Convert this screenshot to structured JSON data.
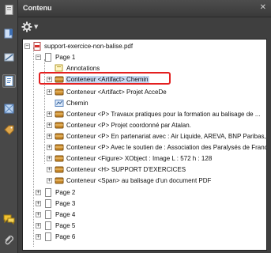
{
  "panel": {
    "title": "Contenu",
    "close": "✕",
    "options_icon": "gear-icon"
  },
  "left_tools": [
    "page-thumbnails-icon",
    "bookmarks-icon",
    "signatures-icon",
    "content-icon",
    "model-tree-icon",
    "tags-icon",
    "comments-icon",
    "attachments-icon"
  ],
  "tree": {
    "root": "support-exercice-non-balise.pdf",
    "page1": "Page 1",
    "page1_children": [
      {
        "label": "Annotations",
        "icon": "annotations-icon",
        "toggle": ""
      },
      {
        "label": "Conteneur <Artifact> Chemin",
        "icon": "container-icon",
        "toggle": "+",
        "selected": true
      },
      {
        "label": "Conteneur <Artifact> Projet AcceDe",
        "icon": "container-icon",
        "toggle": "+"
      },
      {
        "label": "Chemin",
        "icon": "path-icon",
        "toggle": ""
      },
      {
        "label": "Conteneur <P> Travaux pratiques pour la formation au balisage de ...",
        "icon": "container-icon",
        "toggle": "+"
      },
      {
        "label": "Conteneur <P> Projet coordonné par Atalan.",
        "icon": "container-icon",
        "toggle": "+"
      },
      {
        "label": "Conteneur <P> En partenariat avec : Air Liquide, AREVA, BNP Paribas, Ca",
        "icon": "container-icon",
        "toggle": "+"
      },
      {
        "label": "Conteneur <P> Avec le soutien de : Association des Paralysés de France (",
        "icon": "container-icon",
        "toggle": "+"
      },
      {
        "label": "Conteneur <Figure> XObject : Image  L : 572 h : 128",
        "icon": "container-icon",
        "toggle": "+"
      },
      {
        "label": "Conteneur <H> SUPPORT D'EXERCICES",
        "icon": "container-icon",
        "toggle": "+"
      },
      {
        "label": "Conteneur <Span> au balisage d'un document PDF",
        "icon": "container-icon",
        "toggle": "+"
      }
    ],
    "pages": [
      "Page 2",
      "Page 3",
      "Page 4",
      "Page 5",
      "Page 6"
    ]
  }
}
